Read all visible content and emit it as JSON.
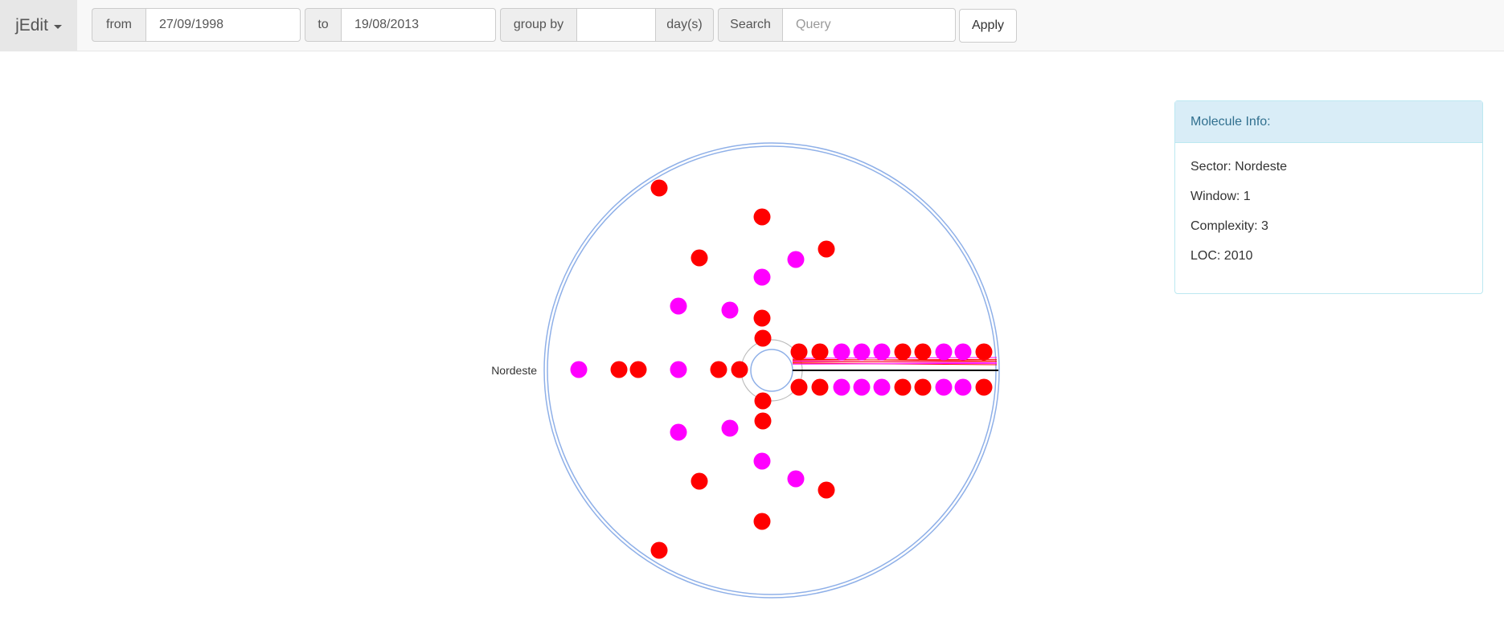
{
  "app": {
    "brand": "jEdit"
  },
  "filters": {
    "from_label": "from",
    "from_value": "27/09/1998",
    "to_label": "to",
    "to_value": "19/08/2013",
    "group_by_label": "group by",
    "group_by_value": "",
    "group_by_unit": "day(s)",
    "search_label": "Search",
    "search_placeholder": "Query",
    "search_value": "",
    "apply_label": "Apply"
  },
  "visualization": {
    "sector_label": "Nordeste",
    "colors": {
      "red": "#ff0000",
      "magenta": "#ff00ff",
      "ring": "#8fb0e8",
      "inner_ring": "#bbbbbb"
    }
  },
  "molecule_info": {
    "title": "Molecule Info:",
    "sector": "Sector: Nordeste",
    "window": "Window: 1",
    "complexity": "Complexity: 3",
    "loc": "LOC: 2010"
  }
}
